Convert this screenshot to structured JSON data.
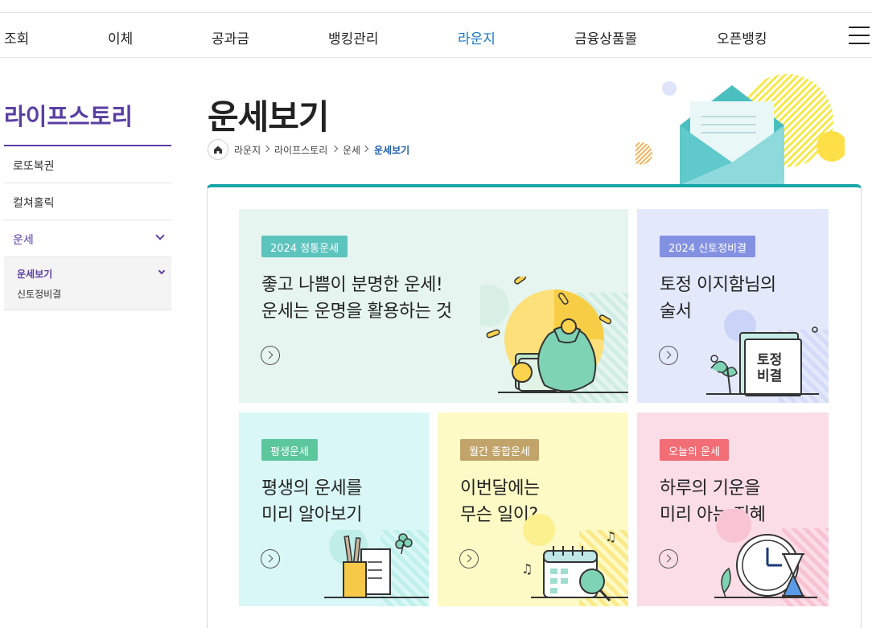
{
  "nav": {
    "items": [
      "조회",
      "이체",
      "공과금",
      "뱅킹관리",
      "라운지",
      "금융상품몰",
      "오픈뱅킹"
    ],
    "active": "라운지",
    "menu_icon": "hamburger-menu-icon"
  },
  "sidebar": {
    "title": "라이프스토리",
    "items": [
      {
        "label": "로또복권"
      },
      {
        "label": "컬쳐홀릭"
      },
      {
        "label": "운세"
      }
    ],
    "sub_items": [
      {
        "label": "운세보기"
      },
      {
        "label": "신토정비결"
      }
    ]
  },
  "page": {
    "title": "운세보기",
    "breadcrumb": [
      "라운지",
      "라이프스토리",
      "운세",
      "운세보기"
    ]
  },
  "cards": [
    {
      "badge": "2024 정통운세",
      "line1": "좋고 나쁨이 분명한 운세!",
      "line2": "운세는 운명을 활용하는 것",
      "icon": "money-bag-icon"
    },
    {
      "badge": "2024 신토정비결",
      "line1": "토정 이지함님의",
      "line2": "술서",
      "icon": "book-icon",
      "book_line1": "토정",
      "book_line2": "비결"
    },
    {
      "badge": "평생운세",
      "line1": "평생의 운세를",
      "line2": "미리 알아보기",
      "icon": "pencil-cup-icon"
    },
    {
      "badge": "월간 종합운세",
      "line1": "이번달에는",
      "line2": "무슨 일이?",
      "icon": "calendar-icon"
    },
    {
      "badge": "오늘의 운세",
      "line1": "하루의 기운을",
      "line2": "미리 아는 지혜",
      "icon": "clock-icon"
    }
  ],
  "colors": {
    "accent": "#1a78c2",
    "sidebar": "#5a3fa3",
    "panel_top": "#1aa6a6",
    "card1_bg": "#e6f5f0",
    "card2_bg": "#e3e9fb",
    "card3_bg": "#d9f7f6",
    "card4_bg": "#fdfac6",
    "card5_bg": "#fbdde7",
    "badge1": "#5cc3bd",
    "badge2": "#8391e2",
    "badge3": "#5cc79c",
    "badge4": "#c2a46a",
    "badge5": "#f26d75"
  }
}
